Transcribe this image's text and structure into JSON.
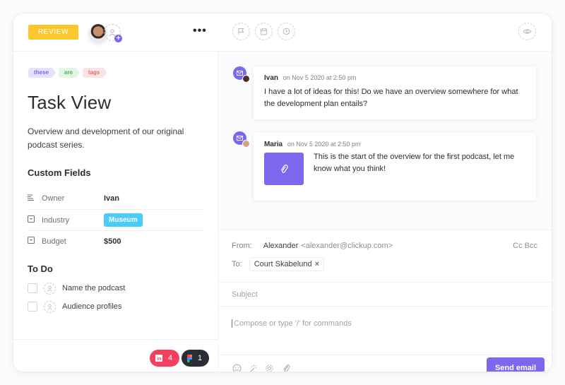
{
  "header": {
    "status": "REVIEW",
    "more_label": "•••",
    "icons": [
      "flag-icon",
      "calendar-icon",
      "clock-icon",
      "eye-icon"
    ]
  },
  "task": {
    "tags": [
      {
        "label": "these",
        "bg": "#e3e1fb",
        "color": "#7b68ee"
      },
      {
        "label": "are",
        "bg": "#e1f5e4",
        "color": "#4caf63"
      },
      {
        "label": "tags",
        "bg": "#fbe3e3",
        "color": "#e06b6b"
      }
    ],
    "title": "Task View",
    "description": "Overview and development of our original podcast series.",
    "custom_fields_heading": "Custom Fields",
    "custom_fields": [
      {
        "label": "Owner",
        "value": "Ivan",
        "icon": "text-field-icon"
      },
      {
        "label": "Industry",
        "value": "Museum",
        "icon": "dropdown-field-icon"
      },
      {
        "label": "Budget",
        "value": "$500",
        "icon": "dropdown-field-icon"
      }
    ],
    "todo_heading": "To Do",
    "todos": [
      {
        "label": "Name the podcast",
        "checked": false
      },
      {
        "label": "Audience profiles",
        "checked": false
      }
    ],
    "integrations": [
      {
        "name": "invision",
        "count": "4",
        "color": "#f43f5e"
      },
      {
        "name": "figma",
        "count": "1",
        "color": "#2a2e34"
      }
    ]
  },
  "comments": [
    {
      "author": "Ivan",
      "timestamp": "on Nov 5 2020 at 2:50 pm",
      "text": "I have a lot of ideas for this! Do we have an overview somewhere for what the development plan entails?"
    },
    {
      "author": "Maria",
      "timestamp": "on Nov 5 2020 at 2:50 pm",
      "text": "This is the start of the overview for the first podcast, let me know what you think!"
    }
  ],
  "email": {
    "from_label": "From:",
    "from_name": "Alexander",
    "from_address": "<alexander@clickup.com>",
    "cc_bcc": "Cc Bcc",
    "to_label": "To:",
    "to_recipient": "Court Skabelund",
    "remove_symbol": "×",
    "subject_placeholder": "Subject",
    "compose_placeholder": "Compose or type '/' for commands",
    "send_label": "Send email"
  },
  "colors": {
    "accent": "#7b68ee",
    "review": "#fcc72c",
    "museum": "#49ccf9"
  }
}
